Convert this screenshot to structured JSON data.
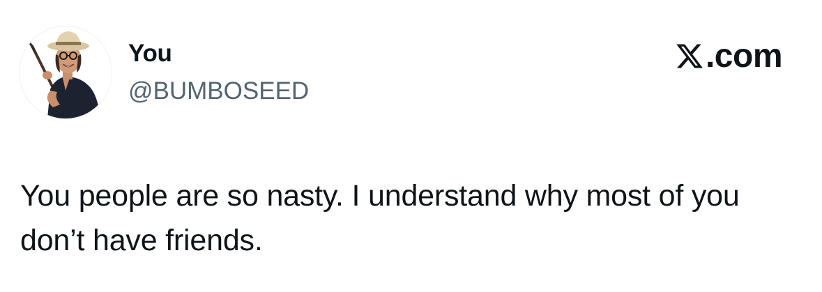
{
  "author": {
    "display_name": "You",
    "handle": "@BUMBOSEED",
    "avatar_icon": "profile-photo-man-with-safari-hat-and-rifle"
  },
  "brand": {
    "icon": "x-logo-icon",
    "domain_suffix": ".com"
  },
  "tweet": {
    "text": "You people are so nasty. I understand why most of you don’t have friends."
  },
  "colors": {
    "text_primary": "#0f1419",
    "text_secondary": "#536471",
    "background": "#ffffff"
  }
}
